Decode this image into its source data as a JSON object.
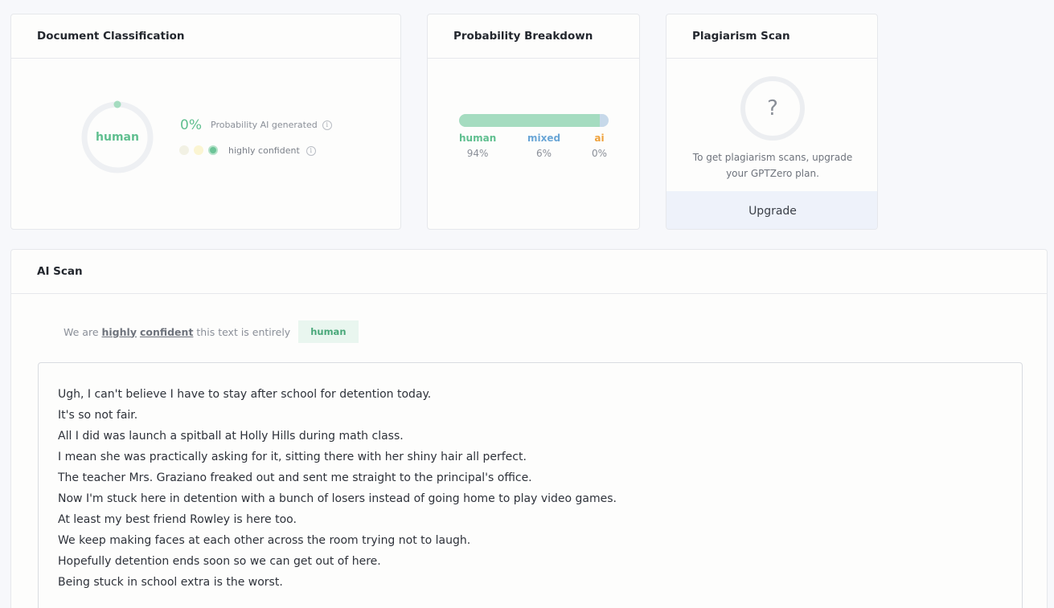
{
  "doc_classification": {
    "title": "Document Classification",
    "label": "human",
    "percent": "0%",
    "probability_label": "Probability AI generated",
    "confidence_label": "highly confident",
    "colors": {
      "human": "#5fbf8f",
      "ring": "#eceef1",
      "dot1": "#f2f1e4",
      "dot2": "#fbf5d2",
      "dot3": "#6cc497"
    }
  },
  "probability_breakdown": {
    "title": "Probability Breakdown",
    "items": [
      {
        "name": "human",
        "value": "94%",
        "fraction": 0.94,
        "color": "#5fbf8f",
        "bar_color": "#a5dcc0"
      },
      {
        "name": "mixed",
        "value": "6%",
        "fraction": 0.06,
        "color": "#6aa6d6",
        "bar_color": "#c7d9ea"
      },
      {
        "name": "ai",
        "value": "0%",
        "fraction": 0.0,
        "color": "#efa23c",
        "bar_color": "#f5c98c"
      }
    ]
  },
  "plagiarism": {
    "title": "Plagiarism Scan",
    "icon_char": "?",
    "message": "To get plagiarism scans, upgrade your GPTZero plan.",
    "button": "Upgrade"
  },
  "ai_scan": {
    "title": "AI Scan",
    "verdict_prefix": "We are",
    "verdict_word1": "highly",
    "verdict_word2": "confident",
    "verdict_suffix": "this text is entirely",
    "tag": "human",
    "lines": [
      "Ugh, I can't believe I have to stay after school for detention today.",
      "It's so not fair.",
      "All I did was launch a spitball at Holly Hills during math class.",
      "I mean she was practically asking for it, sitting there with her shiny hair all perfect.",
      "The teacher Mrs. Graziano freaked out and sent me straight to the principal's office.",
      "Now I'm stuck here in detention with a bunch of losers instead of going home to play video games.",
      "At least my best friend Rowley is here too.",
      "We keep making faces at each other across the room trying not to laugh.",
      "Hopefully detention ends soon so we can get out of here.",
      "Being stuck in school extra is the worst."
    ]
  }
}
